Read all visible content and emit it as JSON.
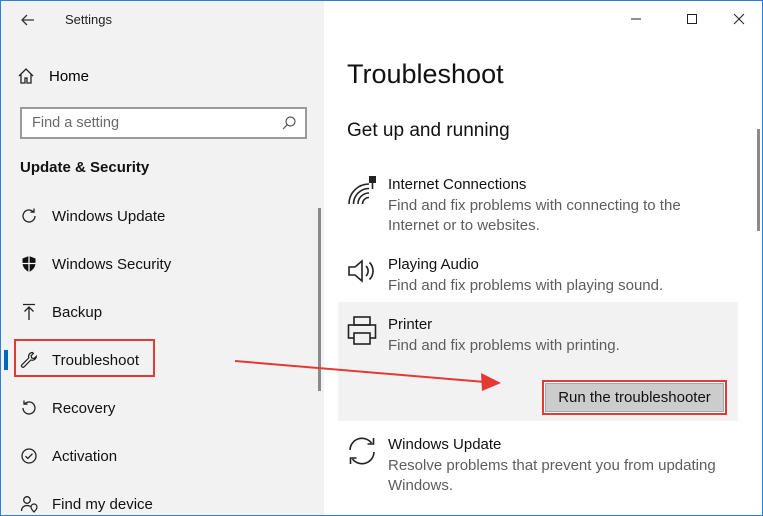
{
  "window": {
    "title": "Settings"
  },
  "sidebar": {
    "home_label": "Home",
    "search_placeholder": "Find a setting",
    "section_title": "Update & Security",
    "items": [
      {
        "label": "Windows Update",
        "icon": "refresh-icon"
      },
      {
        "label": "Windows Security",
        "icon": "shield-icon"
      },
      {
        "label": "Backup",
        "icon": "upload-icon"
      },
      {
        "label": "Troubleshoot",
        "icon": "wrench-icon",
        "active": true
      },
      {
        "label": "Recovery",
        "icon": "recovery-icon"
      },
      {
        "label": "Activation",
        "icon": "activation-icon"
      },
      {
        "label": "Find my device",
        "icon": "person-location-icon"
      }
    ]
  },
  "main": {
    "title": "Troubleshoot",
    "subheading": "Get up and running",
    "troubleshooters": [
      {
        "title": "Internet Connections",
        "description": "Find and fix problems with connecting to the Internet or to websites."
      },
      {
        "title": "Playing Audio",
        "description": "Find and fix problems with playing sound."
      },
      {
        "title": "Printer",
        "description": "Find and fix problems with printing.",
        "selected": true
      },
      {
        "title": "Windows Update",
        "description": "Resolve problems that prevent you from updating Windows."
      }
    ],
    "run_button_label": "Run the troubleshooter"
  },
  "colors": {
    "accent": "#0067c0",
    "highlight": "#e53935",
    "sidebar_bg": "#f2f2f2"
  }
}
